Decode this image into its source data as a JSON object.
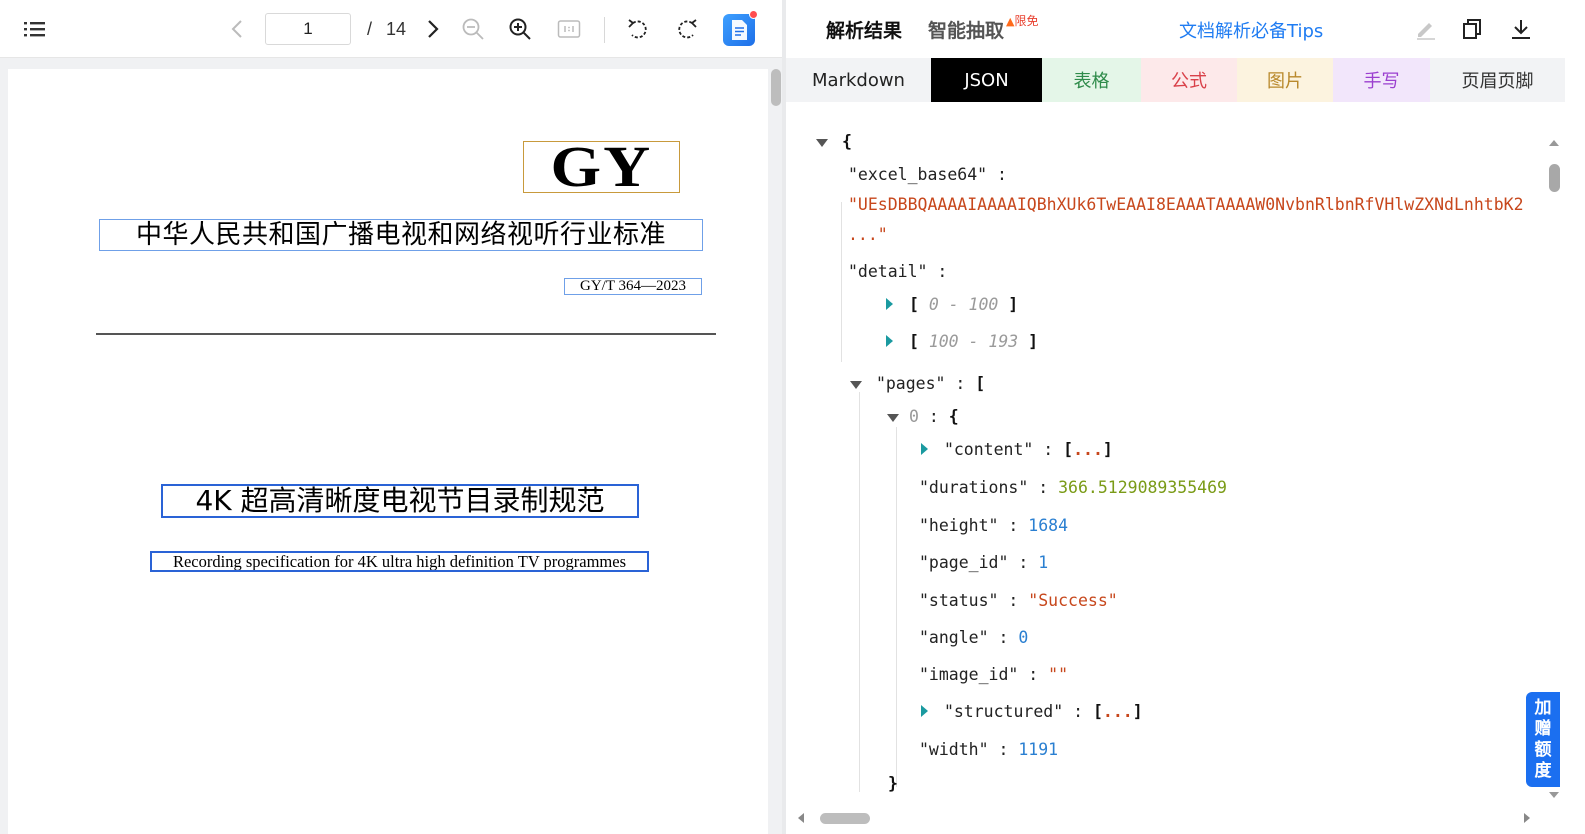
{
  "viewer": {
    "current_page": "1",
    "page_separator": "/",
    "total_pages": "14"
  },
  "document": {
    "logo_text": "GY",
    "standard_title": "中华人民共和国广播电视和网络视听行业标准",
    "standard_code": "GY/T  364—2023",
    "title": "4K 超高清晰度电视节目录制规范",
    "subtitle": "Recording specification for 4K ultra high definition TV programmes"
  },
  "header": {
    "tab_parse": "解析结果",
    "tab_extract": "智能抽取",
    "free_badge": "限免",
    "tips_link": "文档解析必备Tips"
  },
  "format_tabs": [
    {
      "label": "Markdown",
      "bg": "#f2f3f5",
      "color": "#222222"
    },
    {
      "label": "JSON",
      "bg": "#000000",
      "color": "#ffffff"
    },
    {
      "label": "表格",
      "bg": "#e4f6e8",
      "color": "#2e8b4a"
    },
    {
      "label": "公式",
      "bg": "#fde9ea",
      "color": "#d9414a"
    },
    {
      "label": "图片",
      "bg": "#fcf3df",
      "color": "#b9892c"
    },
    {
      "label": "手写",
      "bg": "#f2e6fb",
      "color": "#9b3fcf"
    },
    {
      "label": "页眉页脚",
      "bg": "#f2f3f5",
      "color": "#333333"
    }
  ],
  "json_view": {
    "open_brace": "{",
    "close_brace": "}",
    "excel_key": "\"excel_base64\"",
    "excel_value": "\"UEsDBBQAAAAIAAAAIQBhXUk6TwEAAI8EAAATAAAAW0NvbnRlbnRfVHlwZXNdLnhtbK2",
    "excel_ellipsis": "...\"",
    "detail_key": "\"detail\"",
    "detail_range_1": "0 - 100",
    "detail_range_2": "100 - 193",
    "pages_key": "\"pages\"",
    "page_index": "0",
    "content_key": "\"content\"",
    "durations_key": "\"durations\"",
    "durations_value": "366.5129089355469",
    "height_key": "\"height\"",
    "height_value": "1684",
    "page_id_key": "\"page_id\"",
    "page_id_value": "1",
    "status_key": "\"status\"",
    "status_value": "\"Success\"",
    "angle_key": "\"angle\"",
    "angle_value": "0",
    "image_id_key": "\"image_id\"",
    "image_id_value": "\"\"",
    "structured_key": "\"structured\"",
    "width_key": "\"width\"",
    "width_value": "1191",
    "collapsed": "...",
    "colon": ":",
    "lbracket": "[",
    "rbracket": "]"
  },
  "quota_button": [
    "加",
    "赠",
    "额",
    "度"
  ],
  "colors": {
    "accent": "#1f7cf2",
    "selection_box": "#2a63d6"
  }
}
